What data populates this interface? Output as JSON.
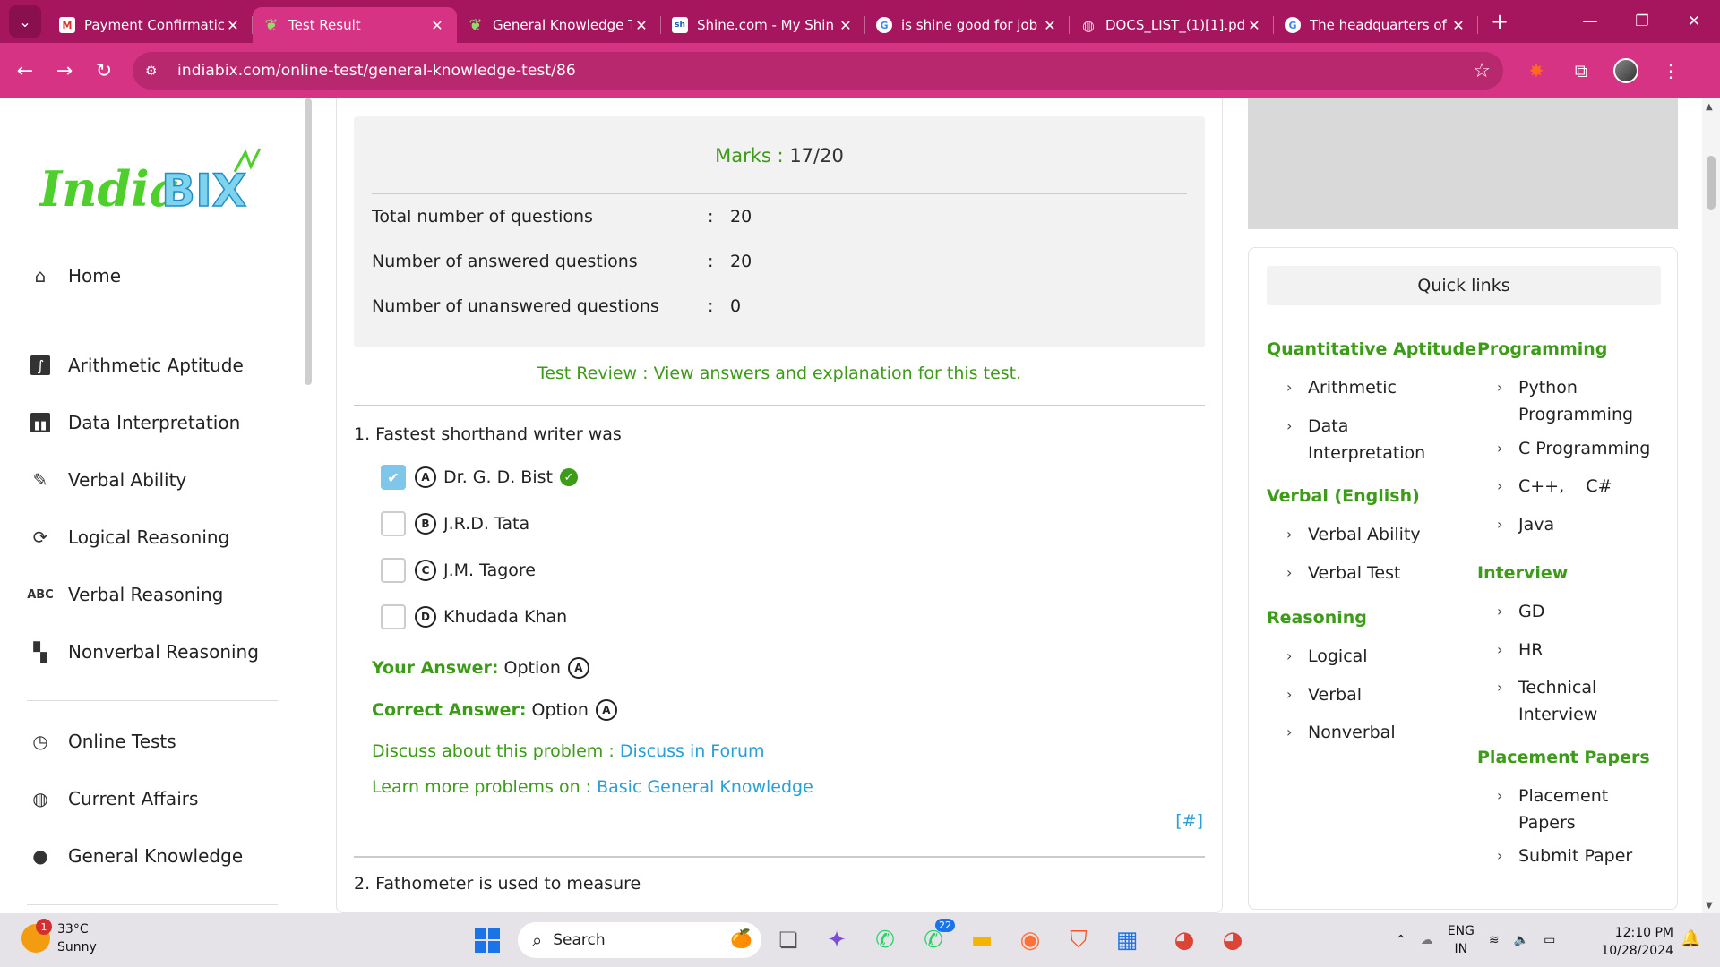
{
  "browser": {
    "tabs": [
      {
        "title": "Payment Confirmatic",
        "favicon": "gmail-icon",
        "active": false
      },
      {
        "title": "Test Result",
        "favicon": "indiabix-icon",
        "active": true
      },
      {
        "title": "General Knowledge T",
        "favicon": "indiabix-icon",
        "active": false
      },
      {
        "title": "Shine.com - My Shin",
        "favicon": "shine-icon",
        "active": false
      },
      {
        "title": "is shine good for job",
        "favicon": "google-icon",
        "active": false
      },
      {
        "title": "DOCS_LIST_(1)[1].pdf",
        "favicon": "globe-icon",
        "active": false
      },
      {
        "title": "The headquarters of",
        "favicon": "google-icon",
        "active": false
      }
    ],
    "url": "indiabix.com/online-test/general-knowledge-test/86",
    "colors": {
      "tabbar": "#a5165f",
      "toolbar": "#d63384"
    }
  },
  "sidebar": {
    "logo_text": "IndiaBIX",
    "items": [
      {
        "label": "Home",
        "icon": "home-icon"
      },
      {
        "label": "Arithmetic Aptitude",
        "icon": "integral-icon"
      },
      {
        "label": "Data Interpretation",
        "icon": "bar-chart-icon"
      },
      {
        "label": "Verbal Ability",
        "icon": "edit-note-icon"
      },
      {
        "label": "Logical Reasoning",
        "icon": "cycle-icon"
      },
      {
        "label": "Verbal Reasoning",
        "icon": "abc-icon"
      },
      {
        "label": "Nonverbal Reasoning",
        "icon": "dashboard-icon"
      },
      {
        "label": "Online Tests",
        "icon": "clock-icon"
      },
      {
        "label": "Current Affairs",
        "icon": "globe-icon"
      },
      {
        "label": "General Knowledge",
        "icon": "bulb-icon"
      }
    ]
  },
  "result": {
    "marks_label": "Marks :",
    "marks_value": "17/20",
    "rows": [
      {
        "label": "Total number of questions",
        "colon": ":",
        "value": "20"
      },
      {
        "label": "Number of answered questions",
        "colon": ":",
        "value": "20"
      },
      {
        "label": "Number of unanswered questions",
        "colon": ":",
        "value": "0"
      }
    ],
    "review_text": "Test Review : View answers and explanation for this test."
  },
  "question1": {
    "text": "1. Fastest shorthand writer was",
    "options": [
      {
        "letter": "A",
        "text": "Dr. G. D. Bist",
        "checked": true,
        "correct": true
      },
      {
        "letter": "B",
        "text": "J.R.D. Tata",
        "checked": false,
        "correct": false
      },
      {
        "letter": "C",
        "text": "J.M. Tagore",
        "checked": false,
        "correct": false
      },
      {
        "letter": "D",
        "text": "Khudada Khan",
        "checked": false,
        "correct": false
      }
    ],
    "your_answer_label": "Your Answer:",
    "your_answer_text": "Option",
    "your_answer_letter": "A",
    "correct_answer_label": "Correct Answer:",
    "correct_answer_text": "Option",
    "correct_answer_letter": "A",
    "discuss_prefix": "Discuss about this problem : ",
    "discuss_link": "Discuss in Forum",
    "learn_prefix": "Learn more problems on : ",
    "learn_link": "Basic General Knowledge",
    "hash_link": "[#]"
  },
  "question2": {
    "text": "2. Fathometer is used to measure"
  },
  "quick_links": {
    "title": "Quick links",
    "col1": [
      {
        "head": "Quantitative Aptitude",
        "items": [
          "Arithmetic",
          "Data Interpretation"
        ]
      },
      {
        "head": "Verbal (English)",
        "items": [
          "Verbal Ability",
          "Verbal Test"
        ]
      },
      {
        "head": "Reasoning",
        "items": [
          "Logical",
          "Verbal",
          "Nonverbal"
        ]
      }
    ],
    "col2": [
      {
        "head": "Programming",
        "items": [
          "Python Programming",
          "C Programming",
          "C++,    C#",
          "Java"
        ]
      },
      {
        "head": "Interview",
        "items": [
          "GD",
          "HR",
          "Technical Interview"
        ]
      },
      {
        "head": "Placement Papers",
        "items": [
          "Placement Papers",
          "Submit Paper"
        ]
      }
    ]
  },
  "taskbar": {
    "weather_temp": "33°C",
    "weather_desc": "Sunny",
    "weather_badge": "1",
    "search_placeholder": "Search",
    "whatsapp_badge": "22",
    "lang_line1": "ENG",
    "lang_line2": "IN",
    "time": "12:10 PM",
    "date": "10/28/2024"
  },
  "colors": {
    "green": "#3c9b17",
    "link_blue": "#2a9fd6",
    "check_blue": "#7ec6ea"
  }
}
